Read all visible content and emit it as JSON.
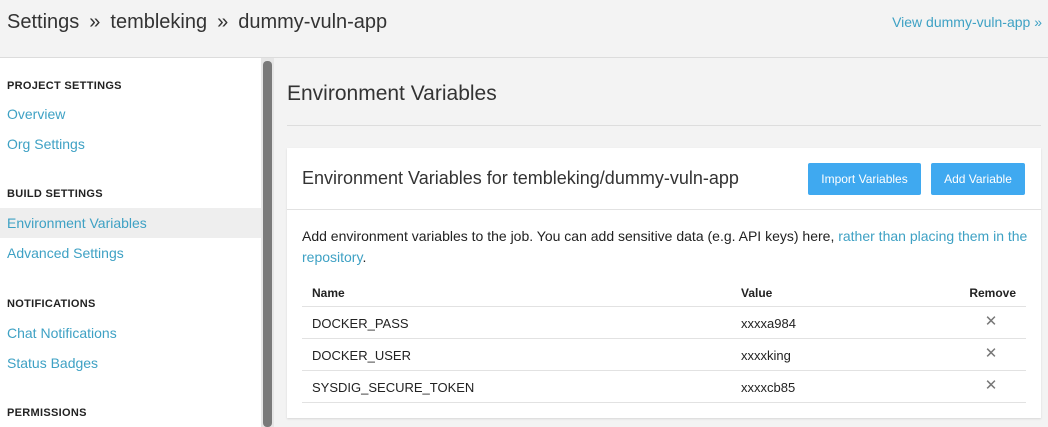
{
  "header": {
    "breadcrumb": [
      "Settings",
      "tembleking",
      "dummy-vuln-app"
    ],
    "separator": "»",
    "view_link": "View dummy-vuln-app »"
  },
  "sidebar": {
    "sections": [
      {
        "heading": "PROJECT SETTINGS",
        "items": [
          "Overview",
          "Org Settings"
        ]
      },
      {
        "heading": "BUILD SETTINGS",
        "items": [
          "Environment Variables",
          "Advanced Settings"
        ]
      },
      {
        "heading": "NOTIFICATIONS",
        "items": [
          "Chat Notifications",
          "Status Badges"
        ]
      },
      {
        "heading": "PERMISSIONS",
        "items": []
      }
    ],
    "active_item": "Environment Variables"
  },
  "main": {
    "title": "Environment Variables",
    "panel": {
      "title": "Environment Variables for tembleking/dummy-vuln-app",
      "import_label": "Import Variables",
      "add_label": "Add Variable",
      "description": "Add environment variables to the job. You can add sensitive data (e.g. API keys) here, ",
      "description_link": "rather than placing them in the repository",
      "description_end": "."
    },
    "table": {
      "headers": {
        "name": "Name",
        "value": "Value",
        "remove": "Remove"
      },
      "rows": [
        {
          "name": "DOCKER_PASS",
          "value": "xxxxa984"
        },
        {
          "name": "DOCKER_USER",
          "value": "xxxxking"
        },
        {
          "name": "SYSDIG_SECURE_TOKEN",
          "value": "xxxxcb85"
        }
      ],
      "remove_glyph": "✕"
    }
  },
  "colors": {
    "accent": "#3ea1c4",
    "button": "#3fa9f0"
  }
}
